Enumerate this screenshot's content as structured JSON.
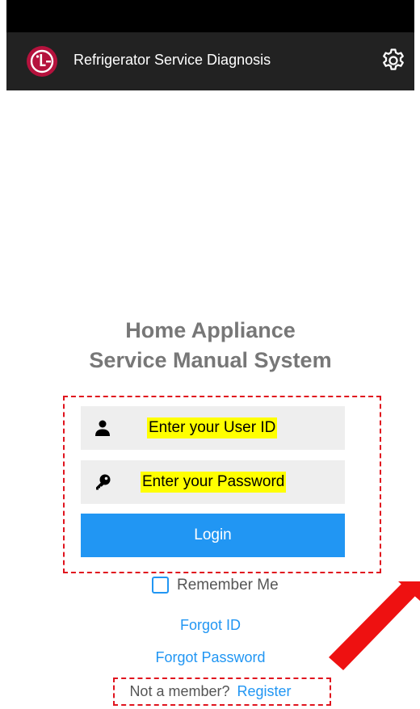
{
  "app_bar": {
    "title": "Refrigerator Service Diagnosis",
    "logo_icon": "lg-logo-icon",
    "settings_icon": "gear-icon",
    "background": "#222222"
  },
  "headline": {
    "line1": "Home Appliance",
    "line2": "Service Manual System"
  },
  "login_form": {
    "user_id_placeholder": "Enter your User ID",
    "password_placeholder": "Enter your Password",
    "user_icon": "person-icon",
    "password_icon": "key-icon",
    "login_label": "Login",
    "remember_me_label": "Remember Me",
    "remember_me_checked": false
  },
  "links": {
    "forgot_id": "Forgot ID",
    "forgot_password": "Forgot Password",
    "register_prompt": "Not a member?",
    "register": "Register"
  },
  "colors": {
    "accent": "#2196f3",
    "logo": "#b5123d",
    "highlight": "#ffff00",
    "annotation": "#e0141e"
  }
}
